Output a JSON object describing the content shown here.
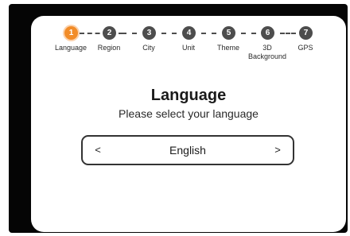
{
  "stepper": {
    "steps": [
      {
        "number": "1",
        "label": "Language"
      },
      {
        "number": "2",
        "label": "Region"
      },
      {
        "number": "3",
        "label": "City"
      },
      {
        "number": "4",
        "label": "Unit"
      },
      {
        "number": "5",
        "label": "Theme"
      },
      {
        "number": "6",
        "label": "3D\nBackground"
      },
      {
        "number": "7",
        "label": "GPS"
      }
    ],
    "active_step": 1,
    "active_color": "#f28c28",
    "inactive_color": "#4d4d4d"
  },
  "main": {
    "title": "Language",
    "subtitle": "Please select your language"
  },
  "selector": {
    "prev_icon": "<",
    "next_icon": ">",
    "value": "English"
  }
}
